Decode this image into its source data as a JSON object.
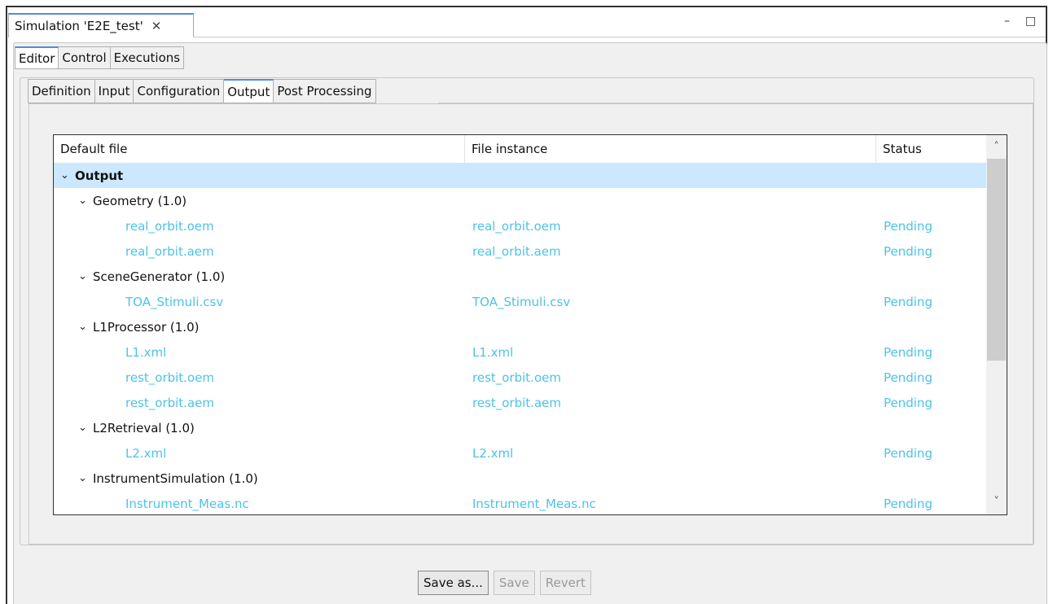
{
  "view": {
    "title": "Simulation 'E2E_test'",
    "close_glyph": "✕",
    "minimize_glyph": "–",
    "maximize_glyph": "□"
  },
  "editor_tabs": [
    "Editor",
    "Control",
    "Executions"
  ],
  "editor_active_tab": "Editor",
  "sub_tabs": [
    "Definition",
    "Input",
    "Configuration",
    "Output",
    "Post Processing"
  ],
  "sub_active_tab": "Output",
  "table": {
    "headers": [
      "Default file",
      "File instance",
      "Status"
    ],
    "rows": [
      {
        "level": 0,
        "label": "Output",
        "instance": "",
        "status": "",
        "group": true,
        "selected": true
      },
      {
        "level": 1,
        "label": "Geometry (1.0)",
        "instance": "",
        "status": "",
        "group": true
      },
      {
        "level": 2,
        "label": "real_orbit.oem",
        "instance": "real_orbit.oem",
        "status": "Pending"
      },
      {
        "level": 2,
        "label": "real_orbit.aem",
        "instance": "real_orbit.aem",
        "status": "Pending"
      },
      {
        "level": 1,
        "label": "SceneGenerator (1.0)",
        "instance": "",
        "status": "",
        "group": true
      },
      {
        "level": 2,
        "label": "TOA_Stimuli.csv",
        "instance": "TOA_Stimuli.csv",
        "status": "Pending"
      },
      {
        "level": 1,
        "label": "L1Processor (1.0)",
        "instance": "",
        "status": "",
        "group": true
      },
      {
        "level": 2,
        "label": "L1.xml",
        "instance": "L1.xml",
        "status": "Pending"
      },
      {
        "level": 2,
        "label": "rest_orbit.oem",
        "instance": "rest_orbit.oem",
        "status": "Pending"
      },
      {
        "level": 2,
        "label": "rest_orbit.aem",
        "instance": "rest_orbit.aem",
        "status": "Pending"
      },
      {
        "level": 1,
        "label": "L2Retrieval (1.0)",
        "instance": "",
        "status": "",
        "group": true
      },
      {
        "level": 2,
        "label": "L2.xml",
        "instance": "L2.xml",
        "status": "Pending"
      },
      {
        "level": 1,
        "label": "InstrumentSimulation (1.0)",
        "instance": "",
        "status": "",
        "group": true
      },
      {
        "level": 2,
        "label": "Instrument_Meas.nc",
        "instance": "Instrument_Meas.nc",
        "status": "Pending"
      }
    ]
  },
  "buttons": {
    "save_as": "Save as...",
    "save": "Save",
    "revert": "Revert"
  },
  "colors": {
    "file_link": "#4dc3e6",
    "selection": "#cce8ff",
    "active_tab_accent": "#4f8fd6"
  },
  "icons": {
    "expand": "chevron-down-icon",
    "scroll_up": "chevron-up-icon",
    "scroll_down": "chevron-down-icon"
  }
}
